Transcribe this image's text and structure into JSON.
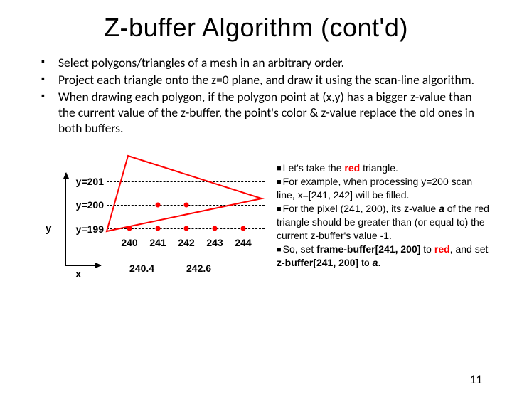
{
  "title": "Z-buffer Algorithm (cont'd)",
  "bullets": {
    "b1_pre": "Select polygons/triangles of a mesh ",
    "b1_under": "in an arbitrary order",
    "b1_post": ".",
    "b2": "Project each triangle onto the z=0 plane, and draw it using the scan-line algorithm.",
    "b3": "When drawing each polygon, if the polygon point at (x,y) has a bigger z-value than the current value of the z-buffer, the point's color & z-value replace the old ones in both buffers."
  },
  "diagram": {
    "y_label": "y",
    "x_label": "x",
    "row201": "y=201",
    "row200": "y=200",
    "row199": "y=199",
    "col240": "240",
    "col241": "241",
    "col242": "242",
    "col243": "243",
    "col244": "244",
    "z2404": "240.4",
    "z2426": "242.6"
  },
  "right": {
    "l1a": "Let's take the ",
    "l1b": "red",
    "l1c": " triangle.",
    "l2": "For example, when processing y=200 scan line, x=[241, 242] will be filled.",
    "l3a": "For the pixel (241, 200), its z-value ",
    "l3b": "a",
    "l3c": " of the red triangle should be greater than (or equal to) the current z-buffer's value -1.",
    "l4a": "So, set ",
    "l4b": "frame-buffer[241, 200]",
    "l4c": " to ",
    "l4d": "red",
    "l4e": ", and set ",
    "l4f": "z-buffer[241, 200]",
    "l4g": " to ",
    "l4h": "a",
    "l4i": "."
  },
  "page": "11"
}
